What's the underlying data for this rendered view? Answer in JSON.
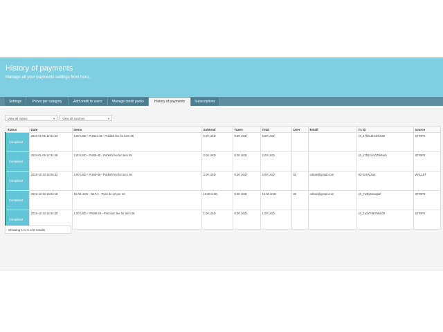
{
  "header": {
    "title": "History of payments",
    "subtitle": "Manage all your payments settings from here."
  },
  "tabs": [
    {
      "label": "Settings"
    },
    {
      "label": "Prices per category"
    },
    {
      "label": "Add credit to users"
    },
    {
      "label": "Manage credit packs"
    },
    {
      "label": "History of payments"
    },
    {
      "label": "Subscriptions"
    }
  ],
  "filters": {
    "status": "View all status",
    "sources": "View all sources"
  },
  "table": {
    "columns": [
      "Status",
      "Date",
      "Items",
      "Subtotal",
      "Taxes",
      "Total",
      "User",
      "Email",
      "Tx ID",
      "source"
    ],
    "rows": [
      {
        "status": "Completed",
        "date": "2016-01-05 12:54:22",
        "items": "5.00 USD - PUB12-46 - Publish fee for item 46",
        "subtotal": "5.00 USD",
        "taxes": "0.00 USD",
        "total": "5.00 USD",
        "user": "",
        "email": "",
        "txid": "ch_17fDsJ2CDfc029",
        "source": "STRIPE"
      },
      {
        "status": "Completed",
        "date": "2016-01-05 12:34:48",
        "items": "2.00 USD - PUB9-45 - Publish fee for item 45",
        "subtotal": "2.00 USD",
        "taxes": "0.00 USD",
        "total": "2.00 USD",
        "user": "",
        "email": "",
        "txid": "ch_17fDVcAZZNvNub",
        "source": "STRIPE"
      },
      {
        "status": "Completed",
        "date": "2015-12-22 16:05:32",
        "items": "2.00 USD - PUB9-39 - Publish fee for item 39",
        "subtotal": "2.00 USD",
        "taxes": "0.00 USD",
        "total": "2.00 USD",
        "user": "82",
        "email": "oribas@gmail.com",
        "txid": "82-33+WJtu4",
        "source": "WALLET"
      },
      {
        "status": "Completed",
        "date": "2015-12-22 16:04:18",
        "items": "10.00 USD - WLT-1 - Pack de 10 por 10",
        "subtotal": "10.00 USD",
        "taxes": "0.00 USD",
        "total": "10.00 USD",
        "user": "82",
        "email": "oribas@gmail.com",
        "txid": "ch_7a3fy5maqlaIf",
        "source": "STRIPE"
      },
      {
        "status": "Completed",
        "date": "2015-12-22 16:04:38",
        "items": "1.00 USD - PRM9-28 - Premium fee for item 38",
        "subtotal": "1.00 USD",
        "taxes": "0.00 USD",
        "total": "1.00 USD",
        "user": "",
        "email": "",
        "txid": "ch_7a2YF857Mvn09",
        "source": "STRIPE"
      }
    ]
  },
  "footer": {
    "showing": "Showing 1 to 5 of 5 results"
  },
  "colors": {
    "banner": "#7ecfe1",
    "tabbar": "#5e8ea0",
    "status_cell": "#62c6d8",
    "status_accent": "#1a9a88"
  }
}
